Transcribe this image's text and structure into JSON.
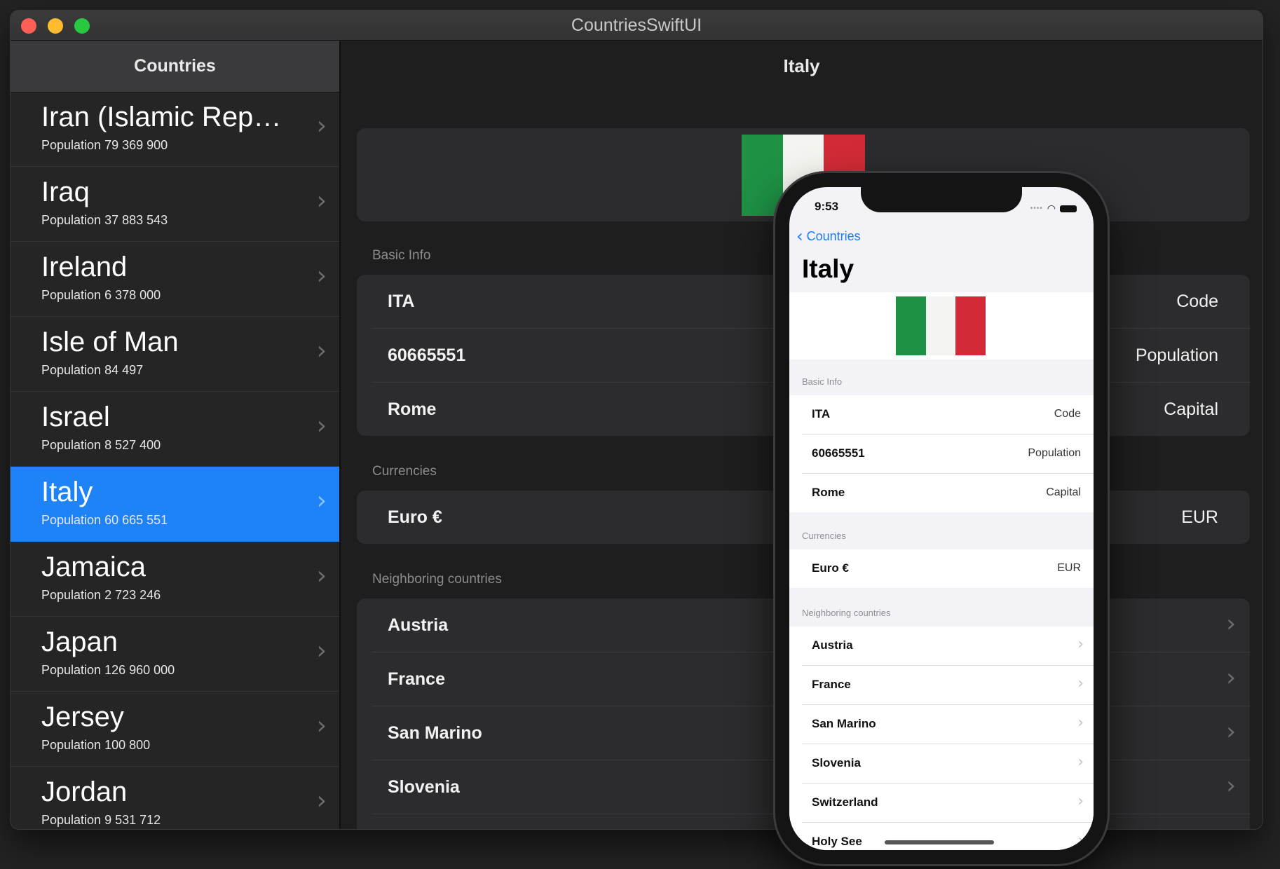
{
  "window": {
    "title": "CountriesSwiftUI"
  },
  "sidebar": {
    "header": "Countries",
    "items": [
      {
        "name": "Iran (Islamic Repu...",
        "population": "Population 79 369 900",
        "selected": false
      },
      {
        "name": "Iraq",
        "population": "Population 37 883 543",
        "selected": false
      },
      {
        "name": "Ireland",
        "population": "Population 6 378 000",
        "selected": false
      },
      {
        "name": "Isle of Man",
        "population": "Population 84 497",
        "selected": false
      },
      {
        "name": "Israel",
        "population": "Population 8 527 400",
        "selected": false
      },
      {
        "name": "Italy",
        "population": "Population 60 665 551",
        "selected": true
      },
      {
        "name": "Jamaica",
        "population": "Population 2 723 246",
        "selected": false
      },
      {
        "name": "Japan",
        "population": "Population 126 960 000",
        "selected": false
      },
      {
        "name": "Jersey",
        "population": "Population 100 800",
        "selected": false
      },
      {
        "name": "Jordan",
        "population": "Population 9 531 712",
        "selected": false
      }
    ]
  },
  "detail": {
    "title": "Italy",
    "flag_colors": [
      "#1e9145",
      "#f4f5f0",
      "#d22b37"
    ],
    "sections": {
      "basic_info": "Basic Info",
      "currencies": "Currencies",
      "neighbors": "Neighboring countries"
    },
    "basic_info": [
      {
        "value": "ITA",
        "label": "Code"
      },
      {
        "value": "60665551",
        "label": "Population"
      },
      {
        "value": "Rome",
        "label": "Capital"
      }
    ],
    "currencies": [
      {
        "value": "Euro €",
        "label": "EUR"
      }
    ],
    "neighbors": [
      "Austria",
      "France",
      "San Marino",
      "Slovenia"
    ]
  },
  "phone": {
    "time": "9:53",
    "back_label": "Countries",
    "title": "Italy",
    "sections": {
      "basic_info": "Basic Info",
      "currencies": "Currencies",
      "neighbors": "Neighboring countries"
    },
    "basic_info": [
      {
        "value": "ITA",
        "label": "Code"
      },
      {
        "value": "60665551",
        "label": "Population"
      },
      {
        "value": "Rome",
        "label": "Capital"
      }
    ],
    "currencies": [
      {
        "value": "Euro €",
        "label": "EUR"
      }
    ],
    "neighbors": [
      "Austria",
      "France",
      "San Marino",
      "Slovenia",
      "Switzerland",
      "Holy See"
    ]
  },
  "icons": {
    "chevron_right": "chevron-right-icon",
    "chevron_left": "chevron-left-icon"
  }
}
